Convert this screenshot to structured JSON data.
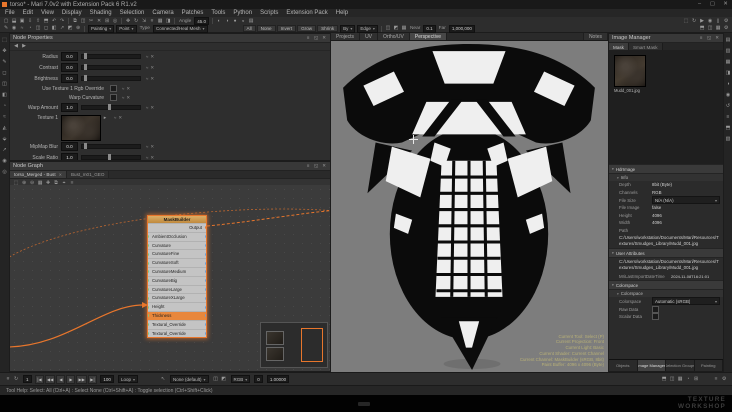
{
  "window": {
    "title": "torso* - Mari 7.0v2 with Extension Pack 6 R1.v2",
    "minimize_glyph": "–",
    "maximize_glyph": "▢",
    "close_glyph": "✕"
  },
  "menu": {
    "items": [
      "File",
      "Edit",
      "View",
      "Display",
      "Shading",
      "Selection",
      "Camera",
      "Patches",
      "Tools",
      "Python",
      "Scripts",
      "Extension Pack",
      "Help"
    ]
  },
  "toolbar1": {
    "angle_label": "Angle",
    "angle_value": "45.0"
  },
  "toolbar2": {
    "paint_combo": "Painting",
    "point_combo": "Point",
    "type_label": "Type",
    "type_combo": "Connected/Heal Mesh",
    "selection_buttons": [
      "All",
      "None",
      "Invert",
      "Grow",
      "Shrink"
    ],
    "by_combo": "By",
    "edge_combo": "Edge",
    "near_label": "Near",
    "near_value": "0.1",
    "far_label": "Far",
    "far_value": "1,000,000"
  },
  "view_tabs": {
    "items": [
      "Projects",
      "UV",
      "Ortho/UV",
      "Perspective"
    ],
    "notes": "Notes"
  },
  "node_properties": {
    "title": "Node Properties",
    "rows": [
      {
        "kind": "slider",
        "label": "Radius",
        "value": "0.0"
      },
      {
        "kind": "slider",
        "label": "Contrast",
        "value": "0.0"
      },
      {
        "kind": "slider",
        "label": "Brightness",
        "value": "0.0"
      },
      {
        "kind": "check",
        "label": "Use Texture 1 Rgb Override"
      },
      {
        "kind": "check",
        "label": "Warp Curvature"
      },
      {
        "kind": "slider",
        "label": "Warp Amount",
        "value": "1.0"
      },
      {
        "kind": "image",
        "label": "Texture 1"
      },
      {
        "kind": "slider",
        "label": "MipMap Blur",
        "value": "0.0"
      },
      {
        "kind": "slider",
        "label": "Scale Ratio",
        "value": "1.0"
      }
    ]
  },
  "node_graph": {
    "title": "Node Graph",
    "tabs": [
      "torso_Merged - Bust",
      "Bust_m01_GEO"
    ],
    "node": {
      "title": "MaskBuilder",
      "output_label": "Output",
      "ports": [
        "AmbientOcclusion",
        "Curvature",
        "CurvatureFine",
        "CurvatureSoft",
        "CurvatureMedium",
        "CurvatureBig",
        "CurvatureLarge",
        "CurvatureXLarge",
        "Height",
        "Thickness",
        "Textural_Override",
        "Textural_Override"
      ],
      "selected_port": "Thickness"
    }
  },
  "hud": {
    "lines": [
      "Current Tool: Select (P)",
      "Current Projection: Front",
      "Current Light: Basic",
      "Current Shader: Current Channel",
      "Current Channel: MaskBuilder (sRGB, 8bit)",
      "Paint Buffer: 4096 x 4096 (Byte)"
    ]
  },
  "image_manager": {
    "title": "Image Manager",
    "tabs": [
      "Mask",
      "Smart Mask"
    ],
    "thumb_label": "Mudd_001.jpg",
    "group1": "HdrImage",
    "group1_sub": "Info",
    "info_rows": [
      {
        "label": "Depth",
        "value": "8bit (Byte)"
      },
      {
        "label": "Channels",
        "value": "RGB"
      },
      {
        "label": "File Size",
        "value": "N/A (N/A)"
      },
      {
        "label": "File Image",
        "value": "false"
      },
      {
        "label": "Height",
        "value": "4096"
      },
      {
        "label": "Width",
        "value": "4096"
      }
    ],
    "path_label": "Path",
    "path_value": "C:/Users/workstation/Documents/Mari/Resources/Textures/Smudges_Library/Mudd_001.jpg",
    "group2": "User Attributes",
    "user_path": "C:/Users/workstation/Documents/Mari/Resources/Textures/Smudges_Library/Mudd_001.jpg",
    "user_attr_label": "MriLastImportDateTime",
    "user_attr_value": "2024-11-08T16:21:01",
    "group3": "Colorspace",
    "group3_sub": "Colorspace",
    "cs_label": "Colorspace",
    "cs_value": "Automatic (sRGB)",
    "raw_label": "Raw Data",
    "scalar_label": "Scalar Data",
    "bottom_tabs": [
      "Objects",
      "Image Manager",
      "Selection Groups",
      "Painting"
    ],
    "active_bottom_tab": "Image Manager"
  },
  "transport": {
    "frame_start": "1",
    "frame_end": "100",
    "loop": "Loop",
    "pointer": "None (default)",
    "channel": "RGB",
    "value_a": "0",
    "value_b": "1.00000"
  },
  "status": {
    "text": "Tool Help: Select: All (Ctrl+A) : Select None (Ctrl+Shift+A) : Toggle selection (Ctrl+Shift+Click)"
  },
  "watermark": {
    "line1": "TEXTURE",
    "line2": "WORKSHOP"
  },
  "colors": {
    "accent": "#e8762c",
    "canvas_gray": "#7d7d7d"
  },
  "icons": {
    "cursor_glyph": "↖",
    "curve_glyph": "≈",
    "reset_glyph": "✕",
    "browse_glyph": "▸",
    "tab_close_glyph": "✕",
    "left_tools": [
      {
        "name": "select-tool-icon",
        "glyph": "⬚"
      },
      {
        "name": "move-object-tool-icon",
        "glyph": "✥"
      },
      {
        "name": "paint-tool-icon",
        "glyph": "✎"
      },
      {
        "name": "eraser-tool-icon",
        "glyph": "◻"
      },
      {
        "name": "clone-stamp-tool-icon",
        "glyph": "◫"
      },
      {
        "name": "gradient-tool-icon",
        "glyph": "◧"
      },
      {
        "name": "blur-tool-icon",
        "glyph": "◔"
      },
      {
        "name": "smear-tool-icon",
        "glyph": "≈"
      },
      {
        "name": "warp-tool-icon",
        "glyph": "◭"
      },
      {
        "name": "slerp-tool-icon",
        "glyph": "⬙"
      },
      {
        "name": "vector-paint-tool-icon",
        "glyph": "↗"
      },
      {
        "name": "color-picker-tool-icon",
        "glyph": "◉"
      },
      {
        "name": "zoom-tool-icon",
        "glyph": "◎"
      }
    ],
    "right_palettes": [
      {
        "name": "channels-palette-icon",
        "glyph": "▤"
      },
      {
        "name": "layers-palette-icon",
        "glyph": "▥"
      },
      {
        "name": "objects-palette-icon",
        "glyph": "▦"
      },
      {
        "name": "shaders-palette-icon",
        "glyph": "◨"
      },
      {
        "name": "lights-palette-icon",
        "glyph": "◑"
      },
      {
        "name": "colors-palette-icon",
        "glyph": "◉"
      },
      {
        "name": "history-palette-icon",
        "glyph": "↺"
      },
      {
        "name": "python-palette-icon",
        "glyph": "≡"
      },
      {
        "name": "projectors-palette-icon",
        "glyph": "⬒"
      },
      {
        "name": "tool-properties-palette-icon",
        "glyph": "▧"
      }
    ],
    "tb1_a": [
      {
        "name": "new-project-icon",
        "glyph": "▢"
      },
      {
        "name": "open-project-icon",
        "glyph": "⬓"
      },
      {
        "name": "save-project-icon",
        "glyph": "▣"
      },
      {
        "name": "import-icon",
        "glyph": "⇩"
      },
      {
        "name": "export-icon",
        "glyph": "⇧"
      },
      {
        "name": "archive-icon",
        "glyph": "⬒"
      },
      {
        "name": "undo-icon",
        "glyph": "↶"
      },
      {
        "name": "redo-icon",
        "glyph": "↷"
      }
    ],
    "tb1_b": [
      {
        "name": "copy-icon",
        "glyph": "⧉"
      },
      {
        "name": "paste-icon",
        "glyph": "◫"
      },
      {
        "name": "cut-icon",
        "glyph": "✂"
      },
      {
        "name": "delete-icon",
        "glyph": "✕"
      },
      {
        "name": "duplicate-icon",
        "glyph": "⊞"
      },
      {
        "name": "search-icon",
        "glyph": "◎"
      }
    ],
    "tb1_c": [
      {
        "name": "move-icon",
        "glyph": "✥"
      },
      {
        "name": "rotate-icon",
        "glyph": "↻"
      },
      {
        "name": "scale-icon",
        "glyph": "⇲"
      },
      {
        "name": "snap-icon",
        "glyph": "#"
      },
      {
        "name": "grid-icon",
        "glyph": "▦"
      },
      {
        "name": "mirror-icon",
        "glyph": "◨"
      }
    ],
    "tb1_d": [
      {
        "name": "flat-lighting-icon",
        "glyph": "◐"
      },
      {
        "name": "basic-lighting-icon",
        "glyph": "◑"
      },
      {
        "name": "full-lighting-icon",
        "glyph": "●"
      },
      {
        "name": "shadows-icon",
        "glyph": "◒"
      },
      {
        "name": "wireframe-icon",
        "glyph": "▤"
      }
    ],
    "tb1_e": [
      {
        "name": "screenshot-icon",
        "glyph": "⬚"
      },
      {
        "name": "turntable-icon",
        "glyph": "↻"
      },
      {
        "name": "playblast-icon",
        "glyph": "▶"
      },
      {
        "name": "color-sample-icon",
        "glyph": "◉"
      },
      {
        "name": "pause-icon",
        "glyph": "||"
      },
      {
        "name": "settings-gear-icon",
        "glyph": "⚙"
      }
    ],
    "tb2_paint": [
      {
        "name": "brush-icon",
        "glyph": "✎"
      },
      {
        "name": "airbrush-icon",
        "glyph": "◉"
      },
      {
        "name": "smear-icon",
        "glyph": "≈"
      },
      {
        "name": "blur-icon",
        "glyph": "◔"
      },
      {
        "name": "clone-icon",
        "glyph": "◫"
      },
      {
        "name": "eraser-icon",
        "glyph": "◻"
      },
      {
        "name": "fill-icon",
        "glyph": "◧"
      },
      {
        "name": "vector-icon",
        "glyph": "↗"
      },
      {
        "name": "mask-icon",
        "glyph": "◩"
      },
      {
        "name": "paint-through-icon",
        "glyph": "⊕"
      }
    ],
    "tb2_mid": [
      {
        "name": "projection-mode-icon",
        "glyph": "◫"
      },
      {
        "name": "mask-preview-icon",
        "glyph": "◩"
      },
      {
        "name": "buffer-icon",
        "glyph": "▦"
      }
    ],
    "tb2_right": [
      {
        "name": "projector-icon",
        "glyph": "⬒"
      },
      {
        "name": "symmetry-icon",
        "glyph": "◫"
      },
      {
        "name": "resolution-icon",
        "glyph": "▦"
      },
      {
        "name": "toolbar-settings-gear-icon",
        "glyph": "⚙"
      }
    ],
    "np_nav": [
      {
        "name": "history-back-icon",
        "glyph": "◀"
      },
      {
        "name": "history-forward-icon",
        "glyph": "▶"
      }
    ],
    "ng_toolbar": [
      {
        "name": "fit-view-icon",
        "glyph": "⬚"
      },
      {
        "name": "zoom-in-icon",
        "glyph": "⊕"
      },
      {
        "name": "zoom-out-icon",
        "glyph": "⊖"
      },
      {
        "name": "snap-grid-icon",
        "glyph": "▦"
      },
      {
        "name": "add-node-icon",
        "glyph": "✚"
      },
      {
        "name": "group-nodes-icon",
        "glyph": "⧉"
      },
      {
        "name": "pin-node-icon",
        "glyph": "⌖"
      },
      {
        "name": "layout-nodes-icon",
        "glyph": "≡"
      }
    ],
    "palette_header": [
      {
        "name": "palette-menu-icon",
        "glyph": "≡"
      },
      {
        "name": "float-palette-icon",
        "glyph": "◱"
      },
      {
        "name": "close-palette-icon",
        "glyph": "✕"
      }
    ],
    "transport_left": [
      {
        "name": "snap-frame-icon",
        "glyph": "#"
      },
      {
        "name": "sync-icon",
        "glyph": "↻"
      }
    ],
    "playback": [
      {
        "name": "go-to-start-button",
        "glyph": "|◀"
      },
      {
        "name": "fast-rewind-button",
        "glyph": "◀◀"
      },
      {
        "name": "step-back-button",
        "glyph": "◀"
      },
      {
        "name": "play-button",
        "glyph": "▶"
      },
      {
        "name": "fast-forward-button",
        "glyph": "▶▶"
      },
      {
        "name": "go-to-end-button",
        "glyph": "▶|"
      }
    ],
    "transport_mid": [
      {
        "name": "isolate-select-icon",
        "glyph": "◫"
      },
      {
        "name": "mask-overlay-icon",
        "glyph": "◩"
      }
    ],
    "transport_right": [
      {
        "name": "projection-toggle-icon",
        "glyph": "⬒"
      },
      {
        "name": "symmetry-toggle-icon",
        "glyph": "◫"
      },
      {
        "name": "paint-buffer-icon",
        "glyph": "▦"
      },
      {
        "name": "blur-toggle-icon",
        "glyph": "◔"
      },
      {
        "name": "grid-toggle-icon",
        "glyph": "⊞"
      }
    ],
    "transport_far": [
      {
        "name": "transport-menu-icon",
        "glyph": "≡"
      },
      {
        "name": "transport-settings-gear-icon",
        "glyph": "⚙"
      }
    ]
  }
}
